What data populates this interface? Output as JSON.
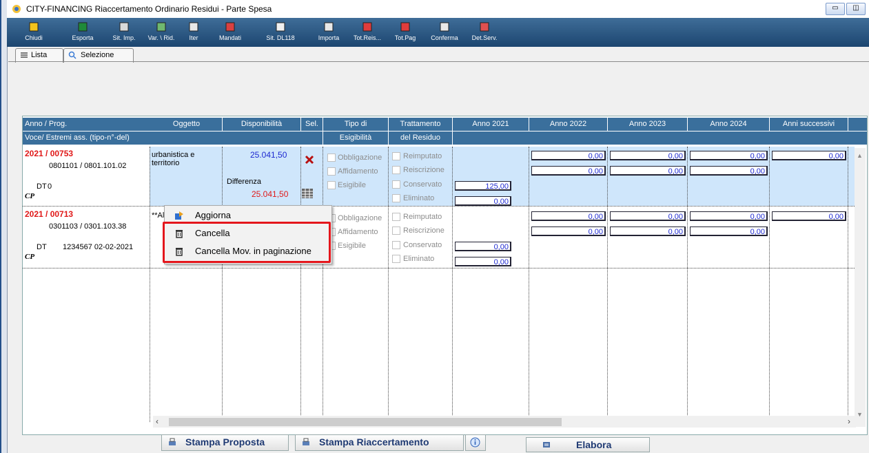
{
  "window": {
    "title": "CITY-FINANCING  Riaccertamento Ordinario Residui - Parte Spesa"
  },
  "toolbar": [
    {
      "label": "Chiudi",
      "color": "#f2c31c"
    },
    {
      "label": "Esporta",
      "color": "#1f8a3a"
    },
    {
      "label": "Sit. Imp.",
      "color": "#d9d9d9"
    },
    {
      "label": "Var. \\ Rid.",
      "color": "#6fb86f"
    },
    {
      "label": "Iter",
      "color": "#e8e8e8"
    },
    {
      "label": "Mandati",
      "color": "#d94040"
    },
    {
      "label": "Sit. DL118",
      "color": "#f0f0f0"
    },
    {
      "label": "Importa",
      "color": "#e8e8e8"
    },
    {
      "label": "Tot.Reis...",
      "color": "#e03c3c"
    },
    {
      "label": "Tot.Pag",
      "color": "#e03c3c"
    },
    {
      "label": "Conferma",
      "color": "#e8e8e8"
    },
    {
      "label": "Det.Serv.",
      "color": "#e05050"
    }
  ],
  "tabs": [
    {
      "label": "Lista"
    },
    {
      "label": "Selezione"
    }
  ],
  "columns": {
    "anno_prog": "Anno / Prog.",
    "voce": "Voce/ Estremi ass. (tipo-n°-del)",
    "oggetto": "Oggetto",
    "disponibilita": "Disponibilità",
    "sel": "Sel.",
    "tipo_di": "Tipo di",
    "esigibilita": "Esigibilità",
    "trattamento": "Trattamento",
    "del_residuo": "del Residuo",
    "anno2021": "Anno 2021",
    "anno2022": "Anno 2022",
    "anno2023": "Anno 2023",
    "anno2024": "Anno 2024",
    "anni_successivi": "Anni successivi"
  },
  "rows": [
    {
      "id": "2021 / 00753",
      "code": "0801101 / 0801.101.02",
      "dt": "DT",
      "dt_value": "0",
      "cp": "CP",
      "oggetto": "urbanistica e territorio",
      "disponibilita": "25.041,50",
      "differenza_label": "Differenza",
      "differenza": "25.041,50",
      "tipo": [
        "Obbligazione",
        "Affidamento",
        "Esigibile"
      ],
      "trattamento": [
        "Reimputato",
        "Reiscrizione",
        "Conservato",
        "Eliminato"
      ],
      "conservato": "125,00",
      "eliminato": "0,00",
      "anno2022": [
        "0,00",
        "0,00"
      ],
      "anno2023": [
        "0,00",
        "0,00"
      ],
      "anno2024": [
        "0,00",
        "0,00"
      ],
      "anni_successivi": "0,00"
    },
    {
      "id": "2021 / 00713",
      "code": "0301103 / 0301.103.38",
      "dt": "DT",
      "dt_value": "1234567 02-02-2021",
      "cp": "CP",
      "oggetto": "**Al",
      "tipo": [
        "Obbligazione",
        "Affidamento",
        "Esigibile"
      ],
      "trattamento": [
        "Reimputato",
        "Reiscrizione",
        "Conservato",
        "Eliminato"
      ],
      "conservato": "0,00",
      "eliminato": "0,00",
      "anno2022": [
        "0,00",
        "0,00"
      ],
      "anno2023": [
        "0,00",
        "0,00"
      ],
      "anno2024": [
        "0,00",
        "0,00"
      ],
      "anni_successivi": "0,00"
    }
  ],
  "context_menu": [
    {
      "label": "Aggiorna",
      "icon": "update-icon"
    },
    {
      "label": "Cancella",
      "icon": "trash-icon"
    },
    {
      "label": "Cancella Mov. in paginazione",
      "icon": "trash-icon"
    }
  ],
  "bottom": {
    "stampa_proposta": "Stampa Proposta",
    "stampa_riaccertamento": "Stampa Riaccertamento",
    "elabora": "Elabora"
  }
}
